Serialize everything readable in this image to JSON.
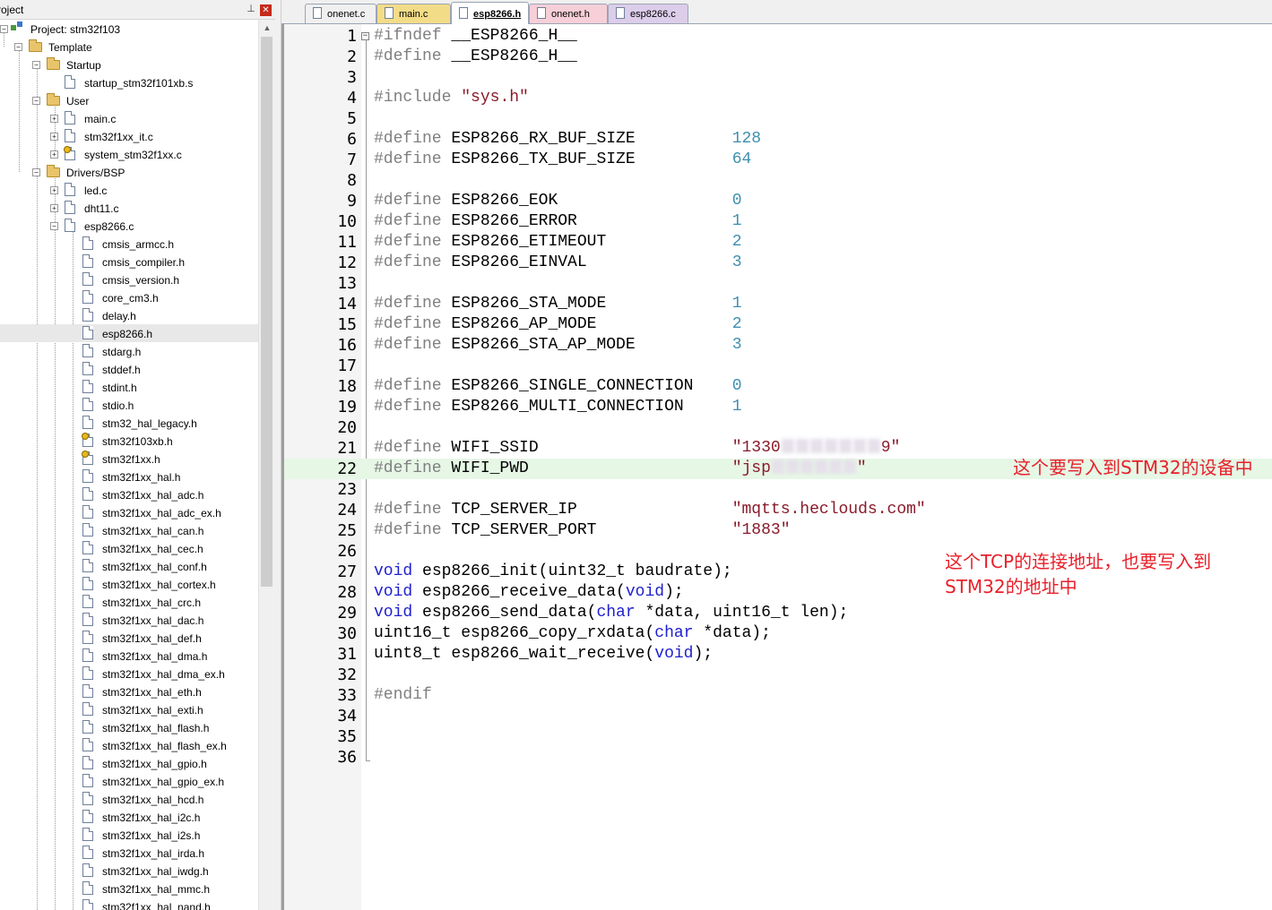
{
  "project_panel": {
    "title": "roject",
    "pin": "⊥",
    "close": "✕",
    "tree": [
      {
        "label": "Project: stm32f103",
        "level": 0,
        "exp": "−",
        "icon": "project-icon"
      },
      {
        "label": "Template",
        "level": 1,
        "exp": "−",
        "icon": "target-folder-icon"
      },
      {
        "label": "Startup",
        "level": 2,
        "exp": "−",
        "icon": "folder-icon"
      },
      {
        "label": "startup_stm32f101xb.s",
        "level": 3,
        "exp": "",
        "icon": "file-icon"
      },
      {
        "label": "User",
        "level": 2,
        "exp": "−",
        "icon": "folder-icon"
      },
      {
        "label": "main.c",
        "level": 3,
        "exp": "+",
        "icon": "file-icon"
      },
      {
        "label": "stm32f1xx_it.c",
        "level": 3,
        "exp": "+",
        "icon": "file-icon"
      },
      {
        "label": "system_stm32f1xx.c",
        "level": 3,
        "exp": "+",
        "icon": "key-file-icon"
      },
      {
        "label": "Drivers/BSP",
        "level": 2,
        "exp": "−",
        "icon": "folder-icon"
      },
      {
        "label": "led.c",
        "level": 3,
        "exp": "+",
        "icon": "file-icon"
      },
      {
        "label": "dht11.c",
        "level": 3,
        "exp": "+",
        "icon": "file-icon"
      },
      {
        "label": "esp8266.c",
        "level": 3,
        "exp": "−",
        "icon": "file-icon"
      },
      {
        "label": "cmsis_armcc.h",
        "level": 4,
        "exp": "",
        "icon": "file-icon"
      },
      {
        "label": "cmsis_compiler.h",
        "level": 4,
        "exp": "",
        "icon": "file-icon"
      },
      {
        "label": "cmsis_version.h",
        "level": 4,
        "exp": "",
        "icon": "file-icon"
      },
      {
        "label": "core_cm3.h",
        "level": 4,
        "exp": "",
        "icon": "file-icon"
      },
      {
        "label": "delay.h",
        "level": 4,
        "exp": "",
        "icon": "file-icon"
      },
      {
        "label": "esp8266.h",
        "level": 4,
        "exp": "",
        "icon": "file-icon",
        "selected": true
      },
      {
        "label": "stdarg.h",
        "level": 4,
        "exp": "",
        "icon": "file-icon"
      },
      {
        "label": "stddef.h",
        "level": 4,
        "exp": "",
        "icon": "file-icon"
      },
      {
        "label": "stdint.h",
        "level": 4,
        "exp": "",
        "icon": "file-icon"
      },
      {
        "label": "stdio.h",
        "level": 4,
        "exp": "",
        "icon": "file-icon"
      },
      {
        "label": "stm32_hal_legacy.h",
        "level": 4,
        "exp": "",
        "icon": "file-icon"
      },
      {
        "label": "stm32f103xb.h",
        "level": 4,
        "exp": "",
        "icon": "key-file-icon"
      },
      {
        "label": "stm32f1xx.h",
        "level": 4,
        "exp": "",
        "icon": "key-file-icon"
      },
      {
        "label": "stm32f1xx_hal.h",
        "level": 4,
        "exp": "",
        "icon": "file-icon"
      },
      {
        "label": "stm32f1xx_hal_adc.h",
        "level": 4,
        "exp": "",
        "icon": "file-icon"
      },
      {
        "label": "stm32f1xx_hal_adc_ex.h",
        "level": 4,
        "exp": "",
        "icon": "file-icon"
      },
      {
        "label": "stm32f1xx_hal_can.h",
        "level": 4,
        "exp": "",
        "icon": "file-icon"
      },
      {
        "label": "stm32f1xx_hal_cec.h",
        "level": 4,
        "exp": "",
        "icon": "file-icon"
      },
      {
        "label": "stm32f1xx_hal_conf.h",
        "level": 4,
        "exp": "",
        "icon": "file-icon"
      },
      {
        "label": "stm32f1xx_hal_cortex.h",
        "level": 4,
        "exp": "",
        "icon": "file-icon"
      },
      {
        "label": "stm32f1xx_hal_crc.h",
        "level": 4,
        "exp": "",
        "icon": "file-icon"
      },
      {
        "label": "stm32f1xx_hal_dac.h",
        "level": 4,
        "exp": "",
        "icon": "file-icon"
      },
      {
        "label": "stm32f1xx_hal_def.h",
        "level": 4,
        "exp": "",
        "icon": "file-icon"
      },
      {
        "label": "stm32f1xx_hal_dma.h",
        "level": 4,
        "exp": "",
        "icon": "file-icon"
      },
      {
        "label": "stm32f1xx_hal_dma_ex.h",
        "level": 4,
        "exp": "",
        "icon": "file-icon"
      },
      {
        "label": "stm32f1xx_hal_eth.h",
        "level": 4,
        "exp": "",
        "icon": "file-icon"
      },
      {
        "label": "stm32f1xx_hal_exti.h",
        "level": 4,
        "exp": "",
        "icon": "file-icon"
      },
      {
        "label": "stm32f1xx_hal_flash.h",
        "level": 4,
        "exp": "",
        "icon": "file-icon"
      },
      {
        "label": "stm32f1xx_hal_flash_ex.h",
        "level": 4,
        "exp": "",
        "icon": "file-icon"
      },
      {
        "label": "stm32f1xx_hal_gpio.h",
        "level": 4,
        "exp": "",
        "icon": "file-icon"
      },
      {
        "label": "stm32f1xx_hal_gpio_ex.h",
        "level": 4,
        "exp": "",
        "icon": "file-icon"
      },
      {
        "label": "stm32f1xx_hal_hcd.h",
        "level": 4,
        "exp": "",
        "icon": "file-icon"
      },
      {
        "label": "stm32f1xx_hal_i2c.h",
        "level": 4,
        "exp": "",
        "icon": "file-icon"
      },
      {
        "label": "stm32f1xx_hal_i2s.h",
        "level": 4,
        "exp": "",
        "icon": "file-icon"
      },
      {
        "label": "stm32f1xx_hal_irda.h",
        "level": 4,
        "exp": "",
        "icon": "file-icon"
      },
      {
        "label": "stm32f1xx_hal_iwdg.h",
        "level": 4,
        "exp": "",
        "icon": "file-icon"
      },
      {
        "label": "stm32f1xx_hal_mmc.h",
        "level": 4,
        "exp": "",
        "icon": "file-icon"
      },
      {
        "label": "stm32f1xx_hal_nand.h",
        "level": 4,
        "exp": "",
        "icon": "file-icon"
      }
    ]
  },
  "tabs": [
    {
      "label": "onenet.c",
      "color": "#f0f0f0",
      "active": false
    },
    {
      "label": "main.c",
      "color": "#f3dc88",
      "active": false
    },
    {
      "label": "esp8266.h",
      "color": "#ffffff",
      "active": true
    },
    {
      "label": "onenet.h",
      "color": "#f6cfd8",
      "active": false
    },
    {
      "label": "esp8266.c",
      "color": "#dccdea",
      "active": false
    }
  ],
  "editor": {
    "highlight_line": 22,
    "lines": [
      [
        [
          "pp",
          "#ifndef"
        ],
        [
          "",
          " __ESP8266_H__"
        ]
      ],
      [
        [
          "pp",
          "#define"
        ],
        [
          "",
          " __ESP8266_H__"
        ]
      ],
      [],
      [
        [
          "pp",
          "#include"
        ],
        [
          "",
          " "
        ],
        [
          "str",
          "\"sys.h\""
        ]
      ],
      [],
      [
        [
          "pp",
          "#define"
        ],
        [
          "",
          " ESP8266_RX_BUF_SIZE          "
        ],
        [
          "num",
          "128"
        ]
      ],
      [
        [
          "pp",
          "#define"
        ],
        [
          "",
          " ESP8266_TX_BUF_SIZE          "
        ],
        [
          "num",
          "64"
        ]
      ],
      [],
      [
        [
          "pp",
          "#define"
        ],
        [
          "",
          " ESP8266_EOK                  "
        ],
        [
          "num",
          "0"
        ]
      ],
      [
        [
          "pp",
          "#define"
        ],
        [
          "",
          " ESP8266_ERROR                "
        ],
        [
          "num",
          "1"
        ]
      ],
      [
        [
          "pp",
          "#define"
        ],
        [
          "",
          " ESP8266_ETIMEOUT             "
        ],
        [
          "num",
          "2"
        ]
      ],
      [
        [
          "pp",
          "#define"
        ],
        [
          "",
          " ESP8266_EINVAL               "
        ],
        [
          "num",
          "3"
        ]
      ],
      [],
      [
        [
          "pp",
          "#define"
        ],
        [
          "",
          " ESP8266_STA_MODE             "
        ],
        [
          "num",
          "1"
        ]
      ],
      [
        [
          "pp",
          "#define"
        ],
        [
          "",
          " ESP8266_AP_MODE              "
        ],
        [
          "num",
          "2"
        ]
      ],
      [
        [
          "pp",
          "#define"
        ],
        [
          "",
          " ESP8266_STA_AP_MODE          "
        ],
        [
          "num",
          "3"
        ]
      ],
      [],
      [
        [
          "pp",
          "#define"
        ],
        [
          "",
          " ESP8266_SINGLE_CONNECTION    "
        ],
        [
          "num",
          "0"
        ]
      ],
      [
        [
          "pp",
          "#define"
        ],
        [
          "",
          " ESP8266_MULTI_CONNECTION     "
        ],
        [
          "num",
          "1"
        ]
      ],
      [],
      [
        [
          "pp",
          "#define"
        ],
        [
          "",
          " WIFI_SSID                    "
        ],
        [
          "str",
          "\"1330"
        ],
        [
          "blur",
          "7"
        ],
        [
          "str",
          "9\""
        ]
      ],
      [
        [
          "pp",
          "#define"
        ],
        [
          "",
          " WIFI_PWD                     "
        ],
        [
          "str",
          "\"jsp"
        ],
        [
          "blur",
          "6"
        ],
        [
          "str",
          "\""
        ]
      ],
      [],
      [
        [
          "pp",
          "#define"
        ],
        [
          "",
          " TCP_SERVER_IP                "
        ],
        [
          "str",
          "\"mqtts.heclouds.com\""
        ]
      ],
      [
        [
          "pp",
          "#define"
        ],
        [
          "",
          " TCP_SERVER_PORT              "
        ],
        [
          "str",
          "\"1883\""
        ]
      ],
      [],
      [
        [
          "kw",
          "void"
        ],
        [
          "",
          " esp8266_init(uint32_t baudrate);"
        ]
      ],
      [
        [
          "kw",
          "void"
        ],
        [
          "",
          " esp8266_receive_data("
        ],
        [
          "kw",
          "void"
        ],
        [
          "",
          ");"
        ]
      ],
      [
        [
          "kw",
          "void"
        ],
        [
          "",
          " esp8266_send_data("
        ],
        [
          "kw",
          "char"
        ],
        [
          "",
          " *data, uint16_t len);"
        ]
      ],
      [
        [
          "",
          "uint16_t esp8266_copy_rxdata("
        ],
        [
          "kw",
          "char"
        ],
        [
          "",
          " *data);"
        ]
      ],
      [
        [
          "",
          "uint8_t esp8266_wait_receive("
        ],
        [
          "kw",
          "void"
        ],
        [
          "",
          ");"
        ]
      ],
      [],
      [
        [
          "pp",
          "#endif"
        ]
      ],
      [],
      [],
      []
    ]
  },
  "annotations": {
    "ssid_note": "这个要写入到STM32的设备中",
    "tcp_note": "这个TCP的连接地址，也要写入到\nSTM32的地址中"
  }
}
